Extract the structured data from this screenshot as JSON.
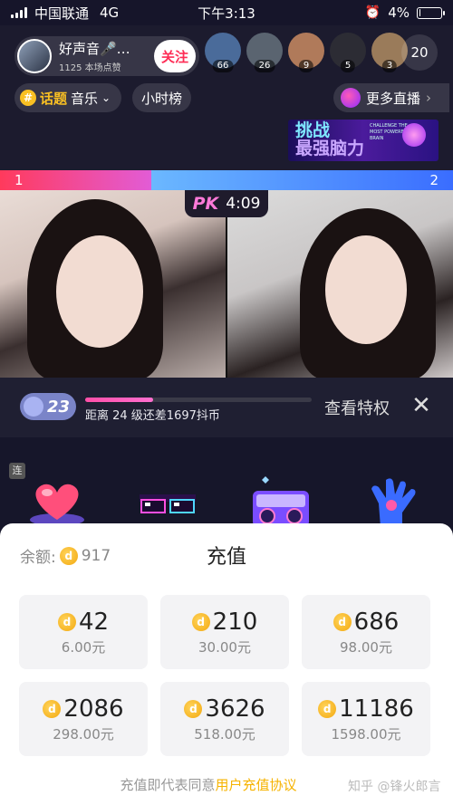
{
  "status_bar": {
    "carrier": "中国联通",
    "network": "4G",
    "time": "下午3:13",
    "battery": "4%",
    "battery_level": 0.04
  },
  "host": {
    "name": "好声音🎤…",
    "likes": "1125 本场点赞",
    "follow_label": "关注"
  },
  "viewers": [
    {
      "badge": "66",
      "color": "#4a6b9a"
    },
    {
      "badge": "26",
      "color": "#5a6470"
    },
    {
      "badge": "9",
      "color": "#b07a5a"
    },
    {
      "badge": "5",
      "color": "#2c2c34"
    },
    {
      "badge": "3",
      "color": "#9a7b5a"
    }
  ],
  "viewer_count": "20",
  "topic": {
    "tag": "话题",
    "category": "音乐",
    "chevron": "chevron-down-icon"
  },
  "hour_rank": "小时榜",
  "more_live": "更多直播",
  "banner": {
    "title_line1": "挑战",
    "title_line2": "最强脑力",
    "subtitle": "CHALLENGE THE MOST POWERFUL BRAIN"
  },
  "pk": {
    "score_left": "1",
    "score_right": "2",
    "icon": "PK",
    "timer": "4:09",
    "left_share": 0.333
  },
  "level": {
    "number": "23",
    "progress": 0.3,
    "text": "距离 24 级还差1697抖币",
    "privilege_label": "查看特权",
    "close_icon": "close-icon"
  },
  "gift_tag": "连",
  "recharge": {
    "balance_label": "余额:",
    "balance_value": "917",
    "title": "充值",
    "packages": [
      {
        "amount": "42",
        "price": "6.00元"
      },
      {
        "amount": "210",
        "price": "30.00元"
      },
      {
        "amount": "686",
        "price": "98.00元"
      },
      {
        "amount": "2086",
        "price": "298.00元"
      },
      {
        "amount": "3626",
        "price": "518.00元"
      },
      {
        "amount": "11186",
        "price": "1598.00元"
      }
    ],
    "agreement_prefix": "充值即代表同意",
    "agreement_link": "用户充值协议"
  },
  "watermark": "知乎 @锋火郎言",
  "colors": {
    "accent_pink": "#fe2c55",
    "coin_gold": "#f3a80e",
    "topic_yellow": "#f9c023"
  }
}
